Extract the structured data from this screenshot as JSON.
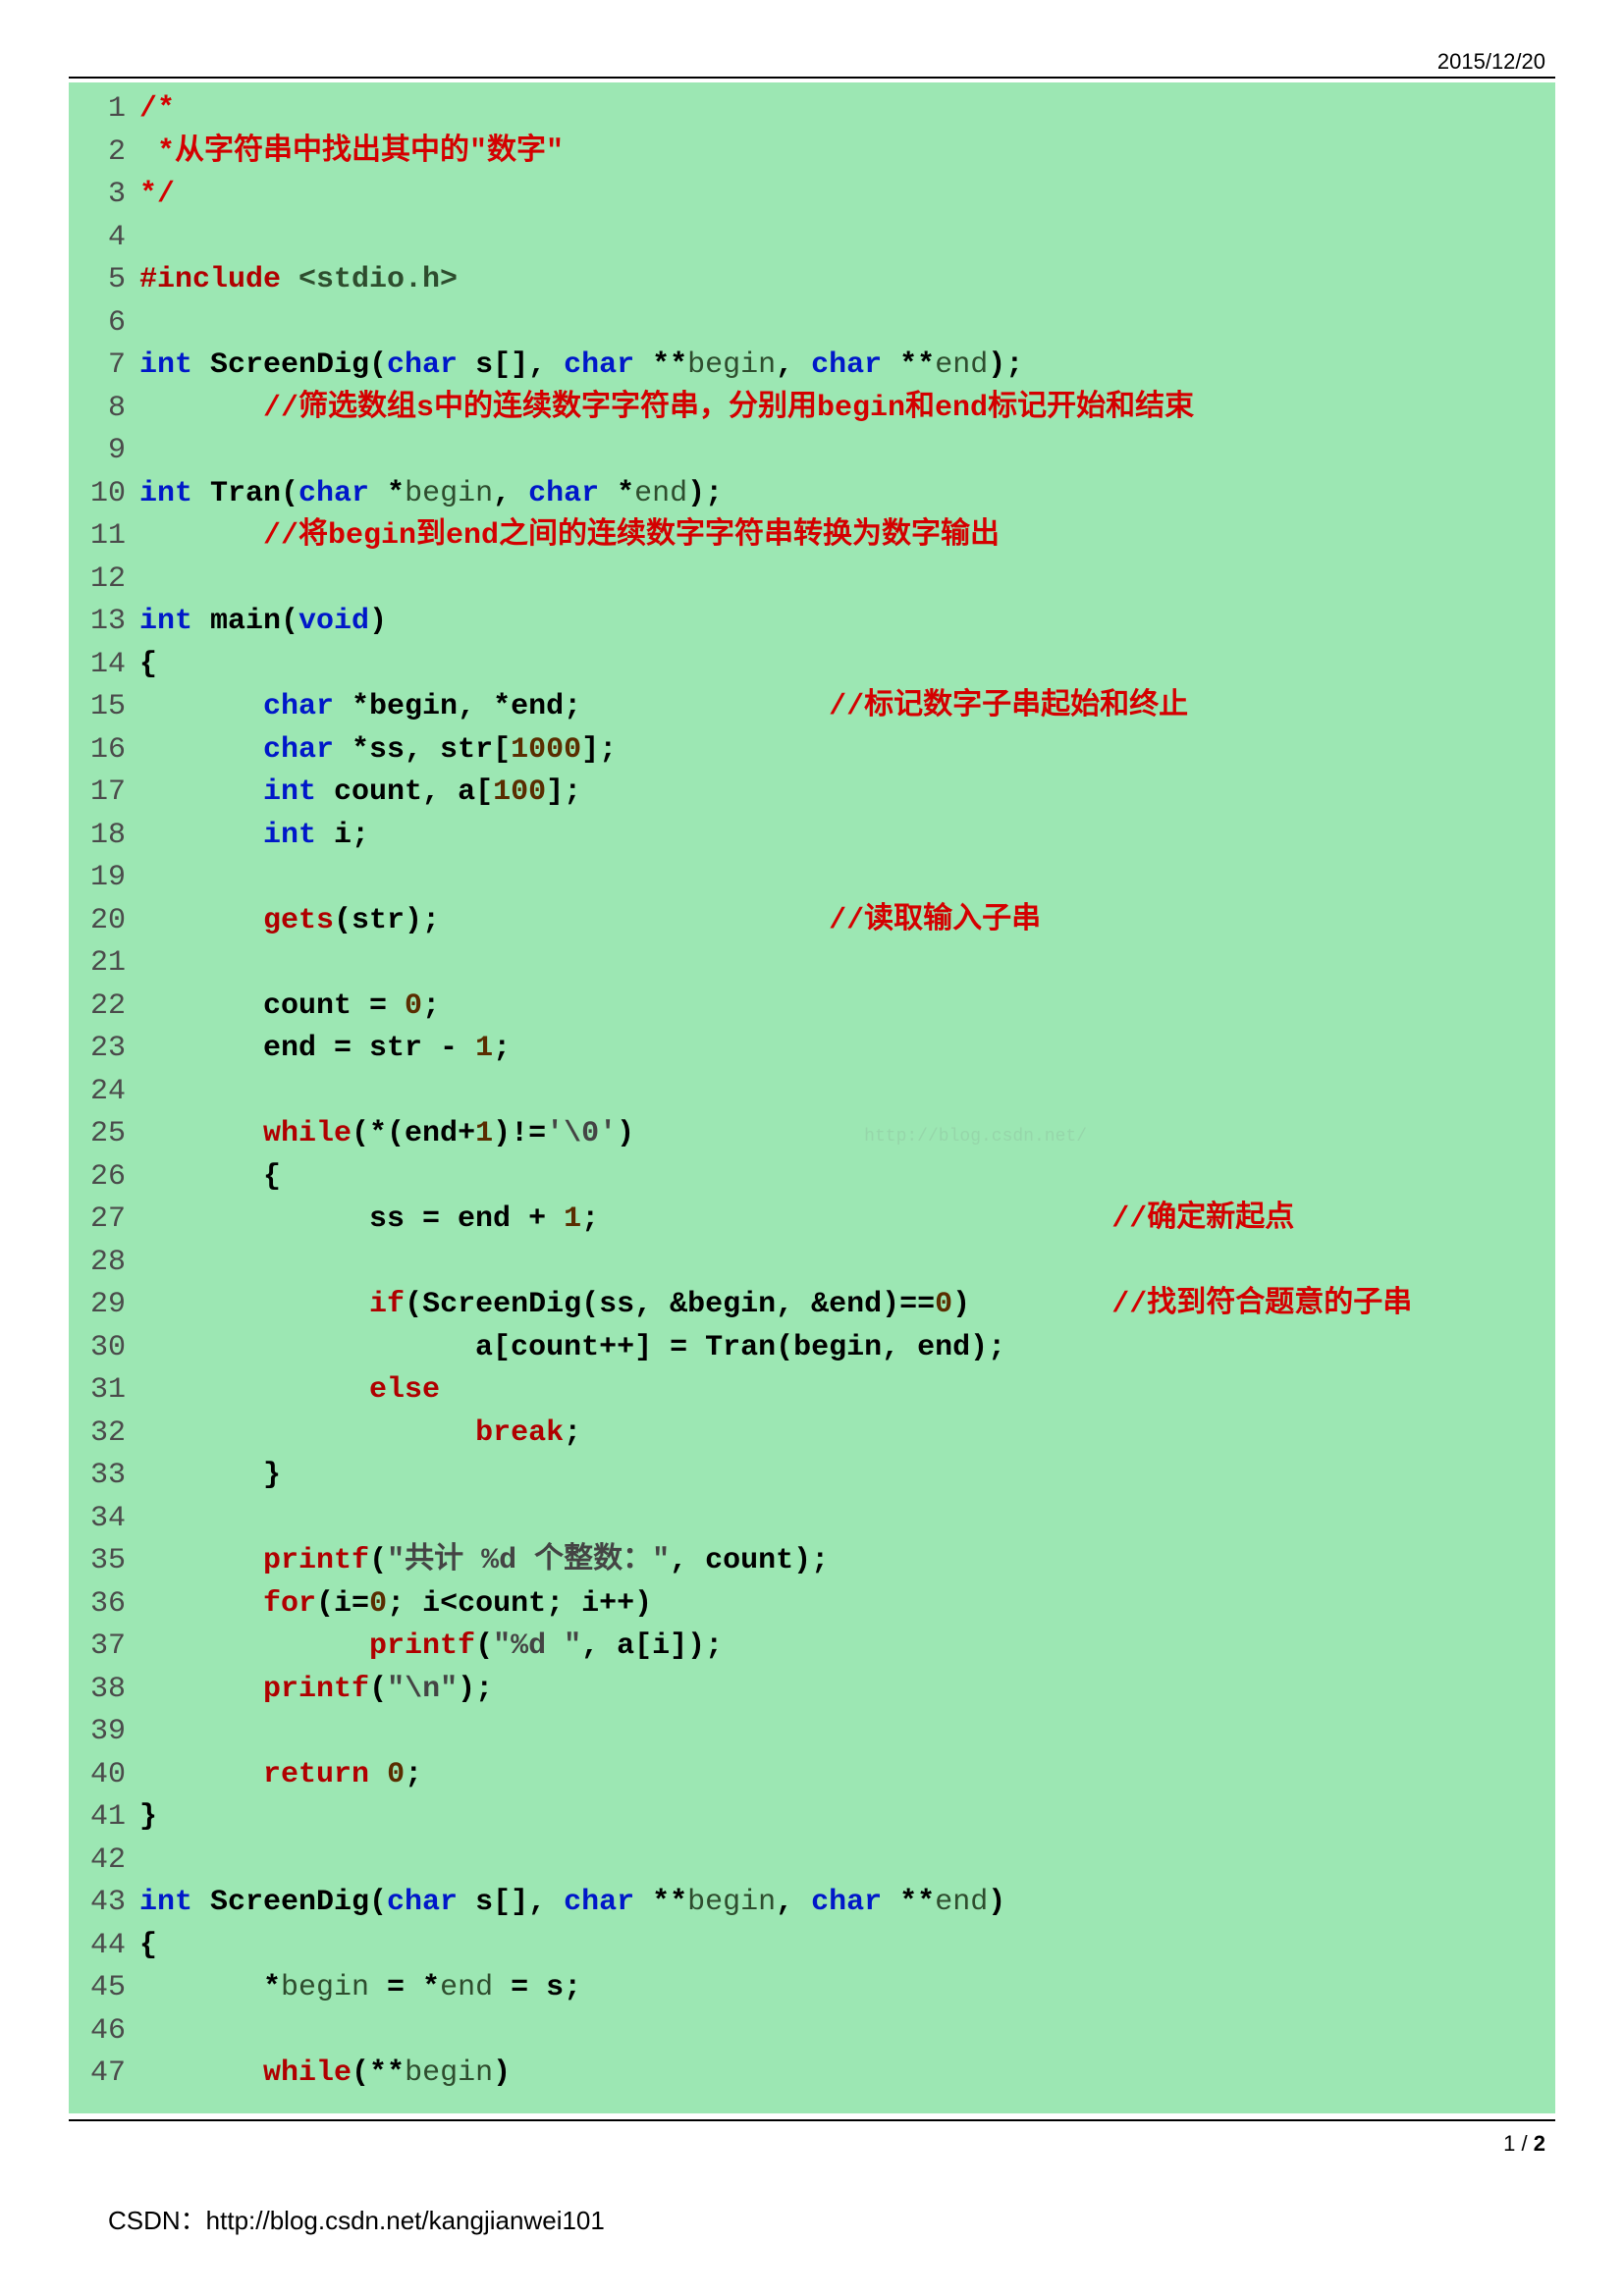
{
  "header": {
    "date": "2015/12/20"
  },
  "watermark": "http://blog.csdn.net/",
  "footer": {
    "source_label": "CSDN：",
    "source_url": "http://blog.csdn.net/kangjianwei101",
    "page_current": "1",
    "page_sep": " / ",
    "page_total": "2"
  },
  "code": {
    "lines": [
      {
        "n": 1,
        "segs": [
          {
            "cls": "c-comment",
            "t": "/*"
          }
        ]
      },
      {
        "n": 2,
        "segs": [
          {
            "cls": "c-comment",
            "t": " *从字符串中找出其中的\"数字\""
          }
        ]
      },
      {
        "n": 3,
        "segs": [
          {
            "cls": "c-comment",
            "t": "*/"
          }
        ]
      },
      {
        "n": 4,
        "segs": []
      },
      {
        "n": 5,
        "segs": [
          {
            "cls": "c-directive",
            "t": "#include "
          },
          {
            "cls": "c-include-file",
            "t": "<stdio.h>"
          }
        ]
      },
      {
        "n": 6,
        "segs": []
      },
      {
        "n": 7,
        "segs": [
          {
            "cls": "c-type",
            "t": "int "
          },
          {
            "cls": "c-plain",
            "t": "ScreenDig("
          },
          {
            "cls": "c-type",
            "t": "char"
          },
          {
            "cls": "c-plain",
            "t": " s[], "
          },
          {
            "cls": "c-type",
            "t": "char "
          },
          {
            "cls": "c-plain",
            "t": "**"
          },
          {
            "cls": "c-ident",
            "t": "begin"
          },
          {
            "cls": "c-plain",
            "t": ", "
          },
          {
            "cls": "c-type",
            "t": "char "
          },
          {
            "cls": "c-plain",
            "t": "**"
          },
          {
            "cls": "c-ident",
            "t": "end"
          },
          {
            "cls": "c-plain",
            "t": ");"
          }
        ]
      },
      {
        "n": 8,
        "segs": [
          {
            "cls": "c-plain",
            "t": "       "
          },
          {
            "cls": "c-comment",
            "t": "//筛选数组s中的连续数字字符串，分别用begin和end标记开始和结束"
          }
        ]
      },
      {
        "n": 9,
        "segs": []
      },
      {
        "n": 10,
        "segs": [
          {
            "cls": "c-type",
            "t": "int "
          },
          {
            "cls": "c-plain",
            "t": "Tran("
          },
          {
            "cls": "c-type",
            "t": "char "
          },
          {
            "cls": "c-plain",
            "t": "*"
          },
          {
            "cls": "c-ident",
            "t": "begin"
          },
          {
            "cls": "c-plain",
            "t": ", "
          },
          {
            "cls": "c-type",
            "t": "char "
          },
          {
            "cls": "c-plain",
            "t": "*"
          },
          {
            "cls": "c-ident",
            "t": "end"
          },
          {
            "cls": "c-plain",
            "t": ");"
          }
        ]
      },
      {
        "n": 11,
        "segs": [
          {
            "cls": "c-plain",
            "t": "       "
          },
          {
            "cls": "c-comment",
            "t": "//将begin到end之间的连续数字字符串转换为数字输出"
          }
        ]
      },
      {
        "n": 12,
        "segs": []
      },
      {
        "n": 13,
        "segs": [
          {
            "cls": "c-type",
            "t": "int "
          },
          {
            "cls": "c-func",
            "t": "main"
          },
          {
            "cls": "c-plain",
            "t": "("
          },
          {
            "cls": "c-type",
            "t": "void"
          },
          {
            "cls": "c-plain",
            "t": ")"
          }
        ]
      },
      {
        "n": 14,
        "segs": [
          {
            "cls": "c-plain",
            "t": "{"
          }
        ]
      },
      {
        "n": 15,
        "segs": [
          {
            "cls": "c-plain",
            "t": "       "
          },
          {
            "cls": "c-type",
            "t": "char "
          },
          {
            "cls": "c-plain",
            "t": "*begin, *end;              "
          },
          {
            "cls": "c-comment",
            "t": "//标记数字子串起始和终止"
          }
        ]
      },
      {
        "n": 16,
        "segs": [
          {
            "cls": "c-plain",
            "t": "       "
          },
          {
            "cls": "c-type",
            "t": "char "
          },
          {
            "cls": "c-plain",
            "t": "*ss, str["
          },
          {
            "cls": "c-num",
            "t": "1000"
          },
          {
            "cls": "c-plain",
            "t": "];"
          }
        ]
      },
      {
        "n": 17,
        "segs": [
          {
            "cls": "c-plain",
            "t": "       "
          },
          {
            "cls": "c-type",
            "t": "int "
          },
          {
            "cls": "c-plain",
            "t": "count, a["
          },
          {
            "cls": "c-num",
            "t": "100"
          },
          {
            "cls": "c-plain",
            "t": "];"
          }
        ]
      },
      {
        "n": 18,
        "segs": [
          {
            "cls": "c-plain",
            "t": "       "
          },
          {
            "cls": "c-type",
            "t": "int "
          },
          {
            "cls": "c-plain",
            "t": "i;"
          }
        ]
      },
      {
        "n": 19,
        "segs": []
      },
      {
        "n": 20,
        "segs": [
          {
            "cls": "c-plain",
            "t": "       "
          },
          {
            "cls": "c-directive",
            "t": "gets"
          },
          {
            "cls": "c-plain",
            "t": "(str);                      "
          },
          {
            "cls": "c-comment",
            "t": "//读取输入子串"
          }
        ]
      },
      {
        "n": 21,
        "segs": []
      },
      {
        "n": 22,
        "segs": [
          {
            "cls": "c-plain",
            "t": "       count = "
          },
          {
            "cls": "c-num",
            "t": "0"
          },
          {
            "cls": "c-plain",
            "t": ";"
          }
        ]
      },
      {
        "n": 23,
        "segs": [
          {
            "cls": "c-plain",
            "t": "       end = str - "
          },
          {
            "cls": "c-num",
            "t": "1"
          },
          {
            "cls": "c-plain",
            "t": ";"
          }
        ]
      },
      {
        "n": 24,
        "segs": []
      },
      {
        "n": 25,
        "segs": [
          {
            "cls": "c-plain",
            "t": "       "
          },
          {
            "cls": "c-directive",
            "t": "while"
          },
          {
            "cls": "c-plain",
            "t": "(*(end+"
          },
          {
            "cls": "c-num",
            "t": "1"
          },
          {
            "cls": "c-plain",
            "t": ")!="
          },
          {
            "cls": "c-string",
            "t": "'\\0'"
          },
          {
            "cls": "c-plain",
            "t": ")             "
          },
          {
            "cls": "watermark",
            "t": "http://blog.csdn.net/"
          }
        ]
      },
      {
        "n": 26,
        "segs": [
          {
            "cls": "c-plain",
            "t": "       {"
          }
        ]
      },
      {
        "n": 27,
        "segs": [
          {
            "cls": "c-plain",
            "t": "             ss = end + "
          },
          {
            "cls": "c-num",
            "t": "1"
          },
          {
            "cls": "c-plain",
            "t": ";                             "
          },
          {
            "cls": "c-comment",
            "t": "//确定新起点"
          }
        ]
      },
      {
        "n": 28,
        "segs": []
      },
      {
        "n": 29,
        "segs": [
          {
            "cls": "c-plain",
            "t": "             "
          },
          {
            "cls": "c-directive",
            "t": "if"
          },
          {
            "cls": "c-plain",
            "t": "(ScreenDig(ss, &begin, &end)=="
          },
          {
            "cls": "c-num",
            "t": "0"
          },
          {
            "cls": "c-plain",
            "t": ")        "
          },
          {
            "cls": "c-comment",
            "t": "//找到符合题意的子串"
          }
        ]
      },
      {
        "n": 30,
        "segs": [
          {
            "cls": "c-plain",
            "t": "                   a[count++] = Tran(begin, end);"
          }
        ]
      },
      {
        "n": 31,
        "segs": [
          {
            "cls": "c-plain",
            "t": "             "
          },
          {
            "cls": "c-directive",
            "t": "else"
          }
        ]
      },
      {
        "n": 32,
        "segs": [
          {
            "cls": "c-plain",
            "t": "                   "
          },
          {
            "cls": "c-directive",
            "t": "break"
          },
          {
            "cls": "c-plain",
            "t": ";"
          }
        ]
      },
      {
        "n": 33,
        "segs": [
          {
            "cls": "c-plain",
            "t": "       }"
          }
        ]
      },
      {
        "n": 34,
        "segs": []
      },
      {
        "n": 35,
        "segs": [
          {
            "cls": "c-plain",
            "t": "       "
          },
          {
            "cls": "c-directive",
            "t": "printf"
          },
          {
            "cls": "c-plain",
            "t": "("
          },
          {
            "cls": "c-string",
            "t": "\"共计 %d 个整数：\""
          },
          {
            "cls": "c-plain",
            "t": ", count);"
          }
        ]
      },
      {
        "n": 36,
        "segs": [
          {
            "cls": "c-plain",
            "t": "       "
          },
          {
            "cls": "c-directive",
            "t": "for"
          },
          {
            "cls": "c-plain",
            "t": "(i="
          },
          {
            "cls": "c-num",
            "t": "0"
          },
          {
            "cls": "c-plain",
            "t": "; i<count; i++)"
          }
        ]
      },
      {
        "n": 37,
        "segs": [
          {
            "cls": "c-plain",
            "t": "             "
          },
          {
            "cls": "c-directive",
            "t": "printf"
          },
          {
            "cls": "c-plain",
            "t": "("
          },
          {
            "cls": "c-string",
            "t": "\"%d \""
          },
          {
            "cls": "c-plain",
            "t": ", a[i]);"
          }
        ]
      },
      {
        "n": 38,
        "segs": [
          {
            "cls": "c-plain",
            "t": "       "
          },
          {
            "cls": "c-directive",
            "t": "printf"
          },
          {
            "cls": "c-plain",
            "t": "("
          },
          {
            "cls": "c-string",
            "t": "\"\\n\""
          },
          {
            "cls": "c-plain",
            "t": ");"
          }
        ]
      },
      {
        "n": 39,
        "segs": []
      },
      {
        "n": 40,
        "segs": [
          {
            "cls": "c-plain",
            "t": "       "
          },
          {
            "cls": "c-directive",
            "t": "return "
          },
          {
            "cls": "c-num",
            "t": "0"
          },
          {
            "cls": "c-plain",
            "t": ";"
          }
        ]
      },
      {
        "n": 41,
        "segs": [
          {
            "cls": "c-plain",
            "t": "}"
          }
        ]
      },
      {
        "n": 42,
        "segs": []
      },
      {
        "n": 43,
        "segs": [
          {
            "cls": "c-type",
            "t": "int "
          },
          {
            "cls": "c-plain",
            "t": "ScreenDig("
          },
          {
            "cls": "c-type",
            "t": "char"
          },
          {
            "cls": "c-plain",
            "t": " s[], "
          },
          {
            "cls": "c-type",
            "t": "char "
          },
          {
            "cls": "c-plain",
            "t": "**"
          },
          {
            "cls": "c-ident",
            "t": "begin"
          },
          {
            "cls": "c-plain",
            "t": ", "
          },
          {
            "cls": "c-type",
            "t": "char "
          },
          {
            "cls": "c-plain",
            "t": "**"
          },
          {
            "cls": "c-ident",
            "t": "end"
          },
          {
            "cls": "c-plain",
            "t": ")"
          }
        ]
      },
      {
        "n": 44,
        "segs": [
          {
            "cls": "c-plain",
            "t": "{"
          }
        ]
      },
      {
        "n": 45,
        "segs": [
          {
            "cls": "c-plain",
            "t": "       *"
          },
          {
            "cls": "c-ident",
            "t": "begin"
          },
          {
            "cls": "c-plain",
            "t": " = *"
          },
          {
            "cls": "c-ident",
            "t": "end"
          },
          {
            "cls": "c-plain",
            "t": " = s;"
          }
        ]
      },
      {
        "n": 46,
        "segs": []
      },
      {
        "n": 47,
        "segs": [
          {
            "cls": "c-plain",
            "t": "       "
          },
          {
            "cls": "c-directive",
            "t": "while"
          },
          {
            "cls": "c-plain",
            "t": "(**"
          },
          {
            "cls": "c-ident",
            "t": "begin"
          },
          {
            "cls": "c-plain",
            "t": ")"
          }
        ]
      }
    ]
  }
}
